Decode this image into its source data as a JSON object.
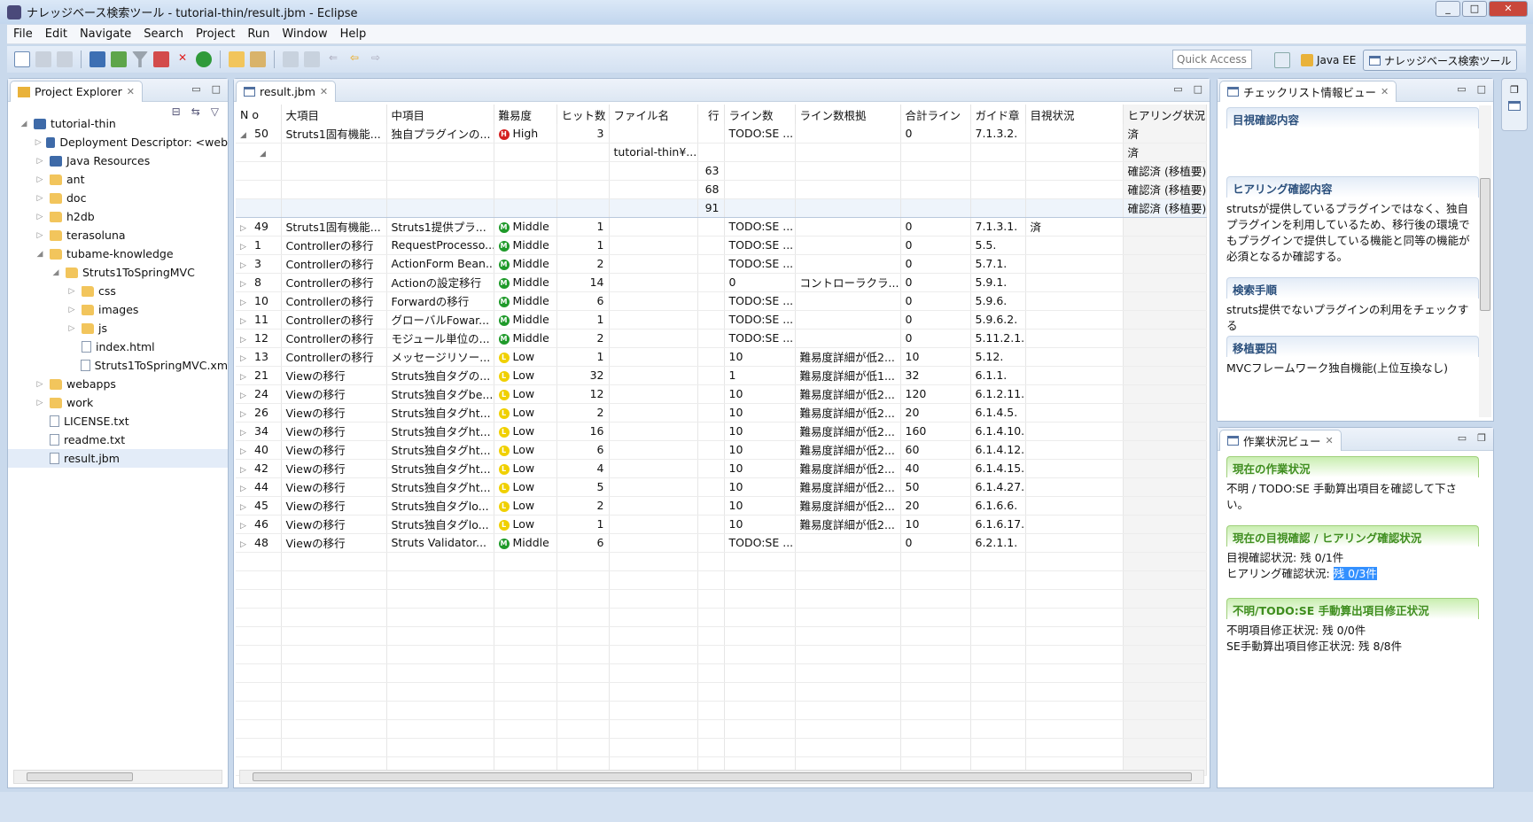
{
  "window": {
    "title": "ナレッジベース検索ツール - tutorial-thin/result.jbm - Eclipse"
  },
  "menu": [
    "File",
    "Edit",
    "Navigate",
    "Search",
    "Project",
    "Run",
    "Window",
    "Help"
  ],
  "toolbar": {
    "quick_access_placeholder": "Quick Access",
    "perspectives": [
      {
        "label": "Java EE",
        "active": false
      },
      {
        "label": "ナレッジベース検索ツール",
        "active": true
      }
    ]
  },
  "project_explorer": {
    "title": "Project Explorer",
    "tree": [
      {
        "label": "tutorial-thin",
        "depth": 0,
        "twisty": "open",
        "icon": "project"
      },
      {
        "label": "Deployment Descriptor: <web",
        "depth": 1,
        "twisty": "closed",
        "icon": "descriptor"
      },
      {
        "label": "Java Resources",
        "depth": 1,
        "twisty": "closed",
        "icon": "java"
      },
      {
        "label": "ant",
        "depth": 1,
        "twisty": "closed",
        "icon": "folder"
      },
      {
        "label": "doc",
        "depth": 1,
        "twisty": "closed",
        "icon": "folder"
      },
      {
        "label": "h2db",
        "depth": 1,
        "twisty": "closed",
        "icon": "folder"
      },
      {
        "label": "terasoluna",
        "depth": 1,
        "twisty": "closed",
        "icon": "folder"
      },
      {
        "label": "tubame-knowledge",
        "depth": 1,
        "twisty": "open",
        "icon": "folder"
      },
      {
        "label": "Struts1ToSpringMVC",
        "depth": 2,
        "twisty": "open",
        "icon": "folder"
      },
      {
        "label": "css",
        "depth": 3,
        "twisty": "closed",
        "icon": "folder"
      },
      {
        "label": "images",
        "depth": 3,
        "twisty": "closed",
        "icon": "folder"
      },
      {
        "label": "js",
        "depth": 3,
        "twisty": "closed",
        "icon": "folder"
      },
      {
        "label": "index.html",
        "depth": 3,
        "twisty": "",
        "icon": "file"
      },
      {
        "label": "Struts1ToSpringMVC.xm",
        "depth": 3,
        "twisty": "",
        "icon": "file"
      },
      {
        "label": "webapps",
        "depth": 1,
        "twisty": "closed",
        "icon": "folder"
      },
      {
        "label": "work",
        "depth": 1,
        "twisty": "closed",
        "icon": "folder"
      },
      {
        "label": "LICENSE.txt",
        "depth": 1,
        "twisty": "",
        "icon": "file"
      },
      {
        "label": "readme.txt",
        "depth": 1,
        "twisty": "",
        "icon": "file"
      },
      {
        "label": "result.jbm",
        "depth": 1,
        "twisty": "",
        "icon": "file",
        "selected": true
      }
    ]
  },
  "editor": {
    "tab": "result.jbm",
    "columns": [
      "N o",
      "大項目",
      "中項目",
      "難易度",
      "ヒット数",
      "ファイル名",
      "行",
      "ライン数",
      "ライン数根拠",
      "合計ライン",
      "ガイド章",
      "目視状況",
      "ヒアリング状況"
    ],
    "level_colors": {
      "High": "#d42020",
      "Middle": "#1f9a2a",
      "Low": "#f0d000"
    },
    "rows": [
      {
        "tw": "open",
        "no": "50",
        "major": "Struts1固有機能...",
        "mid": "独自プラグインの...",
        "level": "High",
        "hits": "3",
        "file": "",
        "line": "",
        "lines": "TODO:SE ...",
        "basis": "",
        "total": "0",
        "guide": "7.1.3.2.",
        "visual": "",
        "hearing": "済"
      },
      {
        "tw": "open2",
        "no": "",
        "major": "",
        "mid": "",
        "level": "",
        "hits": "",
        "file": "tutorial-thin¥...",
        "line": "",
        "lines": "",
        "basis": "",
        "total": "",
        "guide": "",
        "visual": "",
        "hearing": "済"
      },
      {
        "tw": "",
        "no": "",
        "major": "",
        "mid": "",
        "level": "",
        "hits": "",
        "file": "",
        "line": "63",
        "lines": "",
        "basis": "",
        "total": "",
        "guide": "",
        "visual": "",
        "hearing": "確認済 (移植要)"
      },
      {
        "tw": "",
        "no": "",
        "major": "",
        "mid": "",
        "level": "",
        "hits": "",
        "file": "",
        "line": "68",
        "lines": "",
        "basis": "",
        "total": "",
        "guide": "",
        "visual": "",
        "hearing": "確認済 (移植要)"
      },
      {
        "tw": "",
        "no": "",
        "major": "",
        "mid": "",
        "level": "",
        "hits": "",
        "file": "",
        "line": "91",
        "lines": "",
        "basis": "",
        "total": "",
        "guide": "",
        "visual": "",
        "hearing": "確認済 (移植要)",
        "hl": true
      },
      {
        "tw": "closed",
        "no": "49",
        "major": "Struts1固有機能...",
        "mid": "Struts1提供プラ...",
        "level": "Middle",
        "hits": "1",
        "file": "",
        "line": "",
        "lines": "TODO:SE ...",
        "basis": "",
        "total": "0",
        "guide": "7.1.3.1.",
        "visual": "済",
        "hearing": ""
      },
      {
        "tw": "closed",
        "no": "1",
        "major": "Controllerの移行",
        "mid": "RequestProcesso...",
        "level": "Middle",
        "hits": "1",
        "file": "",
        "line": "",
        "lines": "TODO:SE ...",
        "basis": "",
        "total": "0",
        "guide": "5.5.",
        "visual": "",
        "hearing": ""
      },
      {
        "tw": "closed",
        "no": "3",
        "major": "Controllerの移行",
        "mid": "ActionForm Bean...",
        "level": "Middle",
        "hits": "2",
        "file": "",
        "line": "",
        "lines": "TODO:SE ...",
        "basis": "",
        "total": "0",
        "guide": "5.7.1.",
        "visual": "",
        "hearing": ""
      },
      {
        "tw": "closed",
        "no": "8",
        "major": "Controllerの移行",
        "mid": "Actionの設定移行",
        "level": "Middle",
        "hits": "14",
        "file": "",
        "line": "",
        "lines": "0",
        "basis": "コントローラクラ...",
        "total": "0",
        "guide": "5.9.1.",
        "visual": "",
        "hearing": ""
      },
      {
        "tw": "closed",
        "no": "10",
        "major": "Controllerの移行",
        "mid": "Forwardの移行",
        "level": "Middle",
        "hits": "6",
        "file": "",
        "line": "",
        "lines": "TODO:SE ...",
        "basis": "",
        "total": "0",
        "guide": "5.9.6.",
        "visual": "",
        "hearing": ""
      },
      {
        "tw": "closed",
        "no": "11",
        "major": "Controllerの移行",
        "mid": "グローバルFowar...",
        "level": "Middle",
        "hits": "1",
        "file": "",
        "line": "",
        "lines": "TODO:SE ...",
        "basis": "",
        "total": "0",
        "guide": "5.9.6.2.",
        "visual": "",
        "hearing": ""
      },
      {
        "tw": "closed",
        "no": "12",
        "major": "Controllerの移行",
        "mid": "モジュール単位の...",
        "level": "Middle",
        "hits": "2",
        "file": "",
        "line": "",
        "lines": "TODO:SE ...",
        "basis": "",
        "total": "0",
        "guide": "5.11.2.1.",
        "visual": "",
        "hearing": ""
      },
      {
        "tw": "closed",
        "no": "13",
        "major": "Controllerの移行",
        "mid": "メッセージリソー...",
        "level": "Low",
        "hits": "1",
        "file": "",
        "line": "",
        "lines": "10",
        "basis": "難易度詳細が低2...",
        "total": "10",
        "guide": "5.12.",
        "visual": "",
        "hearing": ""
      },
      {
        "tw": "closed",
        "no": "21",
        "major": "Viewの移行",
        "mid": "Struts独自タグの...",
        "level": "Low",
        "hits": "32",
        "file": "",
        "line": "",
        "lines": "1",
        "basis": "難易度詳細が低1...",
        "total": "32",
        "guide": "6.1.1.",
        "visual": "",
        "hearing": ""
      },
      {
        "tw": "closed",
        "no": "24",
        "major": "Viewの移行",
        "mid": "Struts独自タグbe...",
        "level": "Low",
        "hits": "12",
        "file": "",
        "line": "",
        "lines": "10",
        "basis": "難易度詳細が低2...",
        "total": "120",
        "guide": "6.1.2.11.",
        "visual": "",
        "hearing": ""
      },
      {
        "tw": "closed",
        "no": "26",
        "major": "Viewの移行",
        "mid": "Struts独自タグht...",
        "level": "Low",
        "hits": "2",
        "file": "",
        "line": "",
        "lines": "10",
        "basis": "難易度詳細が低2...",
        "total": "20",
        "guide": "6.1.4.5.",
        "visual": "",
        "hearing": ""
      },
      {
        "tw": "closed",
        "no": "34",
        "major": "Viewの移行",
        "mid": "Struts独自タグht...",
        "level": "Low",
        "hits": "16",
        "file": "",
        "line": "",
        "lines": "10",
        "basis": "難易度詳細が低2...",
        "total": "160",
        "guide": "6.1.4.10.",
        "visual": "",
        "hearing": ""
      },
      {
        "tw": "closed",
        "no": "40",
        "major": "Viewの移行",
        "mid": "Struts独自タグht...",
        "level": "Low",
        "hits": "6",
        "file": "",
        "line": "",
        "lines": "10",
        "basis": "難易度詳細が低2...",
        "total": "60",
        "guide": "6.1.4.12.",
        "visual": "",
        "hearing": ""
      },
      {
        "tw": "closed",
        "no": "42",
        "major": "Viewの移行",
        "mid": "Struts独自タグht...",
        "level": "Low",
        "hits": "4",
        "file": "",
        "line": "",
        "lines": "10",
        "basis": "難易度詳細が低2...",
        "total": "40",
        "guide": "6.1.4.15.",
        "visual": "",
        "hearing": ""
      },
      {
        "tw": "closed",
        "no": "44",
        "major": "Viewの移行",
        "mid": "Struts独自タグht...",
        "level": "Low",
        "hits": "5",
        "file": "",
        "line": "",
        "lines": "10",
        "basis": "難易度詳細が低2...",
        "total": "50",
        "guide": "6.1.4.27.",
        "visual": "",
        "hearing": ""
      },
      {
        "tw": "closed",
        "no": "45",
        "major": "Viewの移行",
        "mid": "Struts独自タグlo...",
        "level": "Low",
        "hits": "2",
        "file": "",
        "line": "",
        "lines": "10",
        "basis": "難易度詳細が低2...",
        "total": "20",
        "guide": "6.1.6.6.",
        "visual": "",
        "hearing": ""
      },
      {
        "tw": "closed",
        "no": "46",
        "major": "Viewの移行",
        "mid": "Struts独自タグlo...",
        "level": "Low",
        "hits": "1",
        "file": "",
        "line": "",
        "lines": "10",
        "basis": "難易度詳細が低2...",
        "total": "10",
        "guide": "6.1.6.17.",
        "visual": "",
        "hearing": ""
      },
      {
        "tw": "closed",
        "no": "48",
        "major": "Viewの移行",
        "mid": "Struts Validator...",
        "level": "Middle",
        "hits": "6",
        "file": "",
        "line": "",
        "lines": "TODO:SE ...",
        "basis": "",
        "total": "0",
        "guide": "6.2.1.1.",
        "visual": "",
        "hearing": ""
      }
    ]
  },
  "checklist_view": {
    "title": "チェックリスト情報ビュー",
    "sections": [
      {
        "heading": "目視確認内容",
        "text": ""
      },
      {
        "heading": "ヒアリング確認内容",
        "text": "strutsが提供しているプラグインではなく、独自プラグインを利用しているため、移行後の環境でもプラグインで提供している機能と同等の機能が必須となるか確認する。"
      },
      {
        "heading": "検索手順",
        "text": "struts提供でないプラグインの利用をチェックする"
      },
      {
        "heading": "移植要因",
        "text": "MVCフレームワーク独自機能(上位互換なし)"
      }
    ]
  },
  "work_status_view": {
    "title": "作業状況ビュー",
    "current": {
      "heading": "現在の作業状況",
      "text": "不明 / TODO:SE 手動算出項目を確認して下さい。"
    },
    "confirm": {
      "heading": "現在の目視確認 / ヒアリング確認状況",
      "visual_label": "目視確認状況: ",
      "visual_value": "残 0/1件",
      "hearing_label": "ヒアリング確認状況: ",
      "hearing_value": "残 0/3件"
    },
    "fix": {
      "heading": "不明/TODO:SE 手動算出項目修正状況",
      "unknown_label": "不明項目修正状況: ",
      "unknown_value": "残 0/0件",
      "se_label": "SE手動算出項目修正状況: ",
      "se_value": "残 8/8件"
    }
  }
}
